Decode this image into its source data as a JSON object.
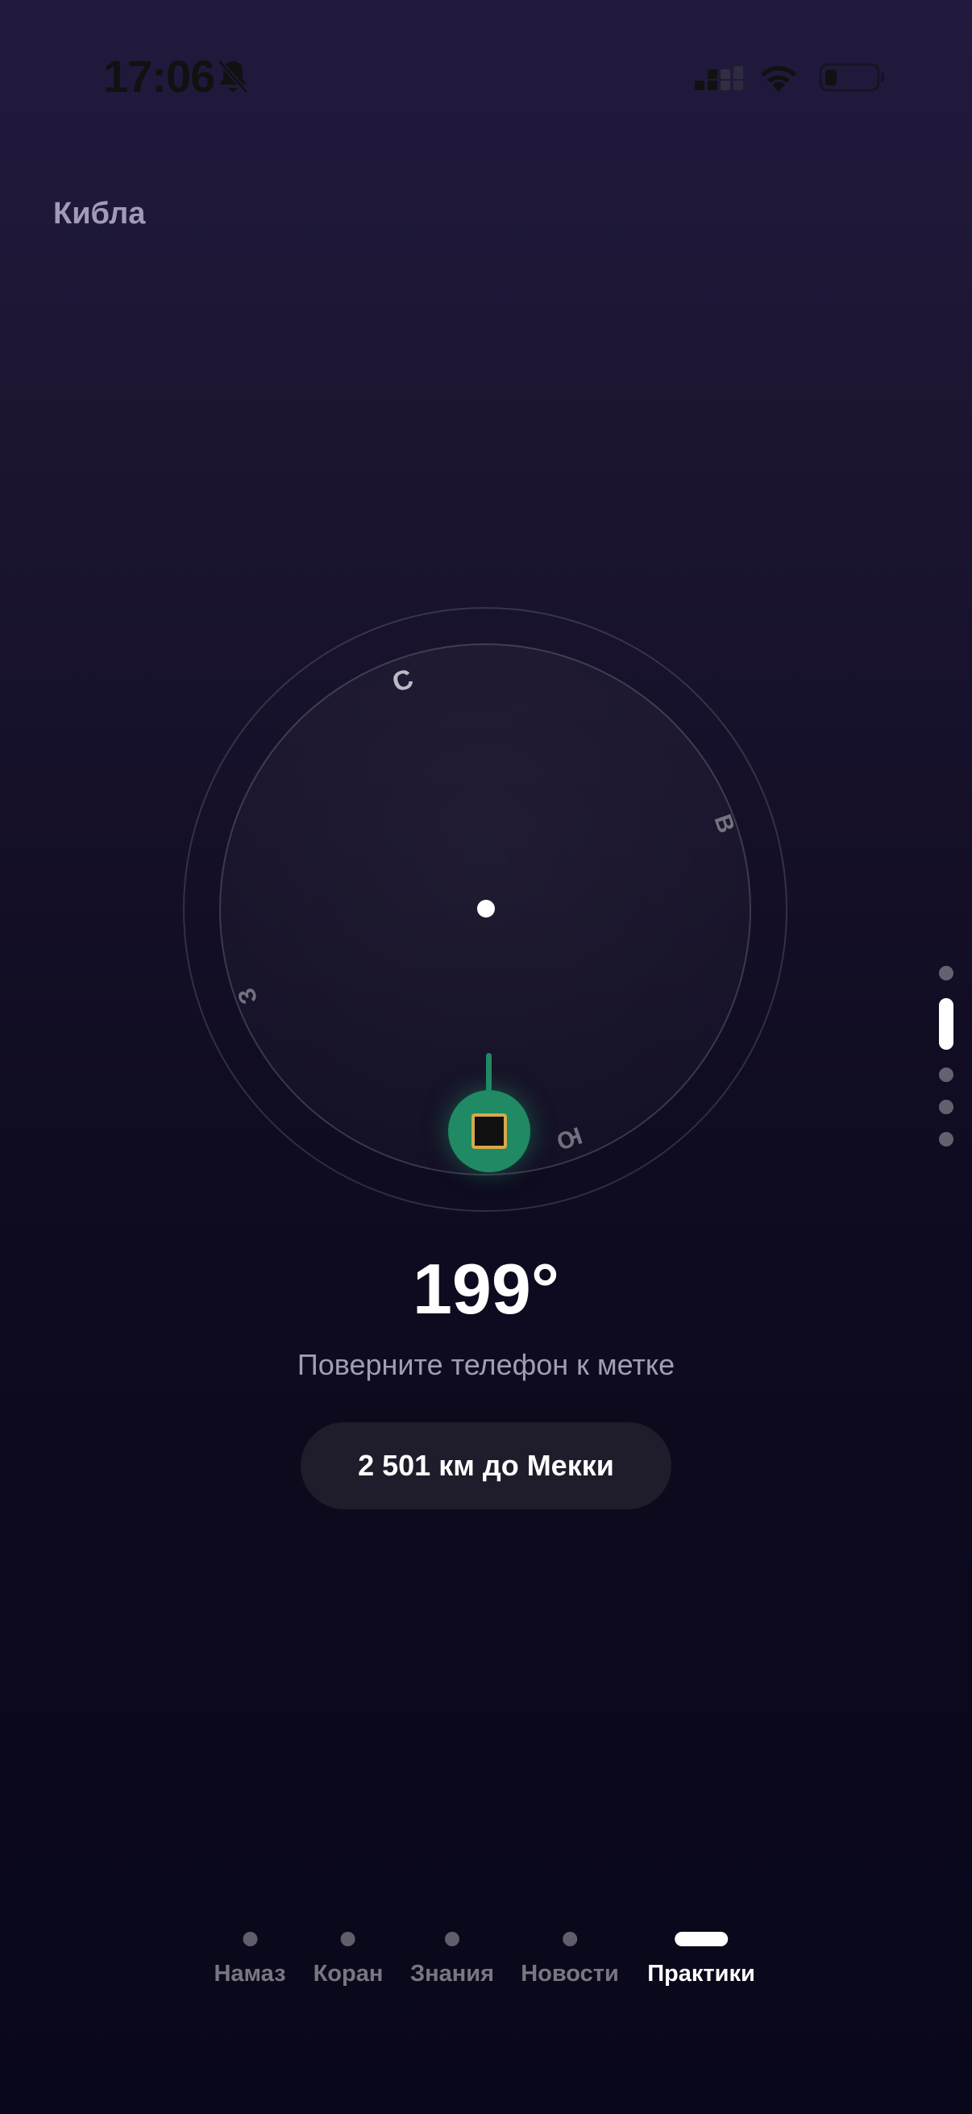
{
  "status_bar": {
    "time": "17:06"
  },
  "header": {
    "title": "Кибла"
  },
  "compass": {
    "directions": {
      "north": "С",
      "east": "В",
      "south": "Ю",
      "west": "З"
    },
    "heading": "199°",
    "instruction": "Поверните телефон к метке",
    "distance": "2 501 км до Мекки",
    "accent_color": "#1f8a63",
    "kaaba_color": "#d8a84a"
  },
  "pager": {
    "pages": 5,
    "active_index": 1
  },
  "nav": {
    "tabs": [
      {
        "label": "Намаз"
      },
      {
        "label": "Коран"
      },
      {
        "label": "Знания"
      },
      {
        "label": "Новости"
      },
      {
        "label": "Практики"
      }
    ],
    "active_tab": "Практики"
  }
}
